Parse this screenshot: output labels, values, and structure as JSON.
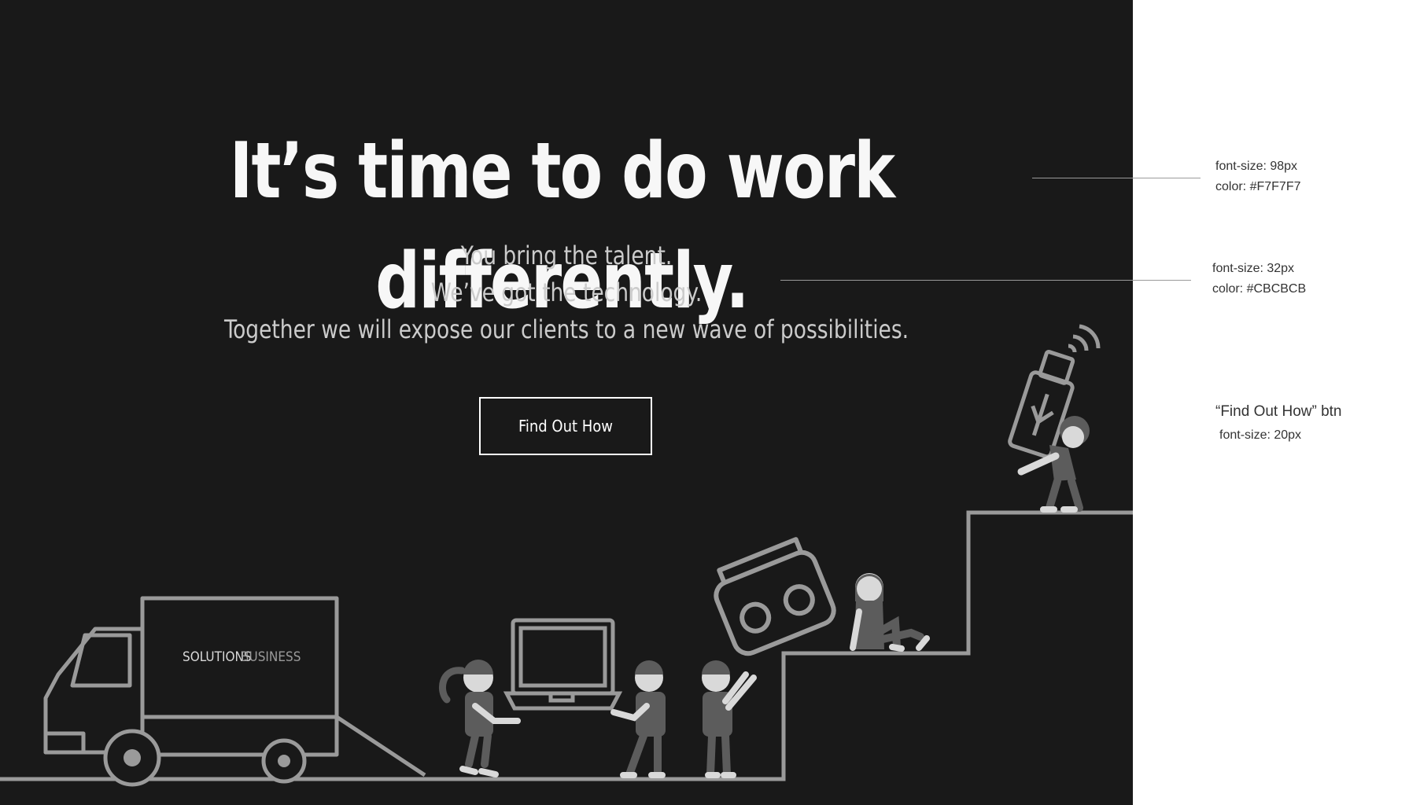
{
  "hero": {
    "headline": "It’s time to do work differently.",
    "subtitle_lines": [
      "You bring the talent.",
      "We’ve got the technology.",
      "Together we will expose our clients to a new wave of possibilities."
    ],
    "cta_label": "Find Out How"
  },
  "truck": {
    "brand_word1": "SOLUTIONS",
    "brand_word2": "BUSINESS"
  },
  "annotations": {
    "headline": {
      "size": "font-size: 98px",
      "color": "color: #F7F7F7"
    },
    "subtitle": {
      "size": "font-size: 32px",
      "color": "color: #CBCBCB"
    },
    "button": {
      "title": "“Find Out How” btn",
      "size": "font-size: 20px"
    }
  },
  "colors": {
    "background": "#191919",
    "headline": "#F7F7F7",
    "subtitle": "#CBCBCB",
    "illustration_line": "#9A9A9A",
    "figure_dark": "#5C5C5C",
    "figure_light": "#D9D9D9"
  }
}
